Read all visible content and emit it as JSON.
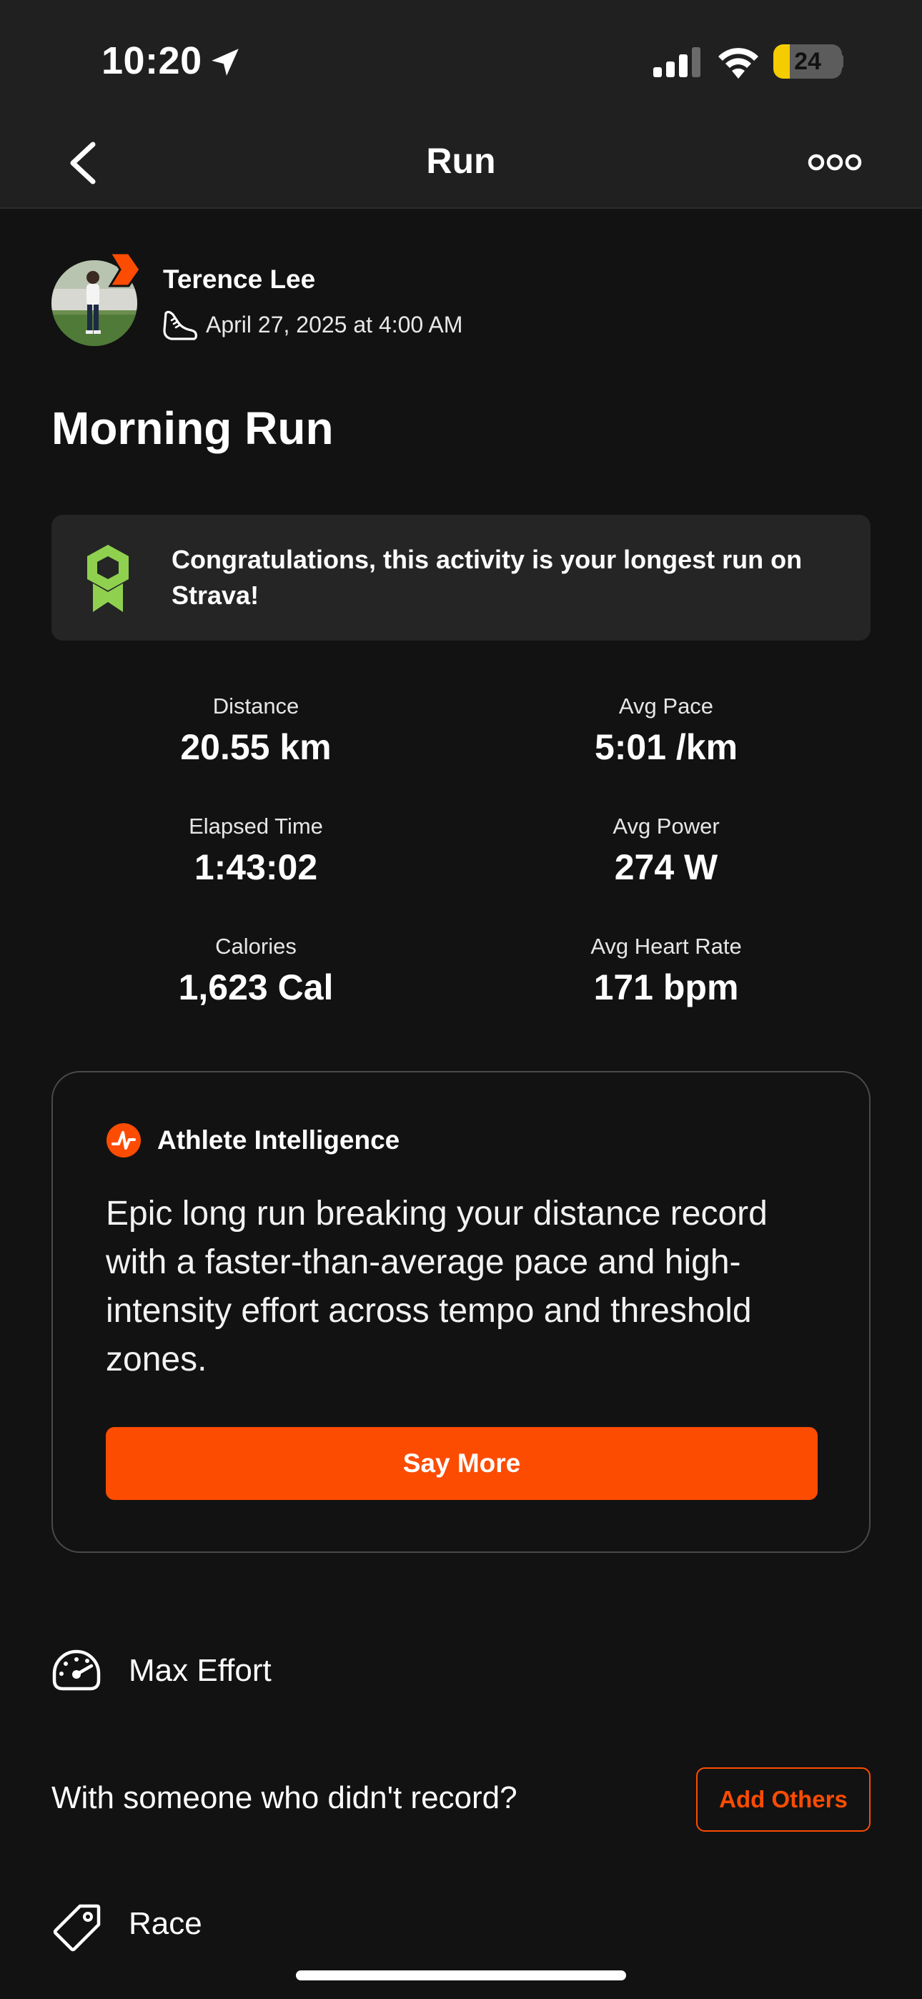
{
  "status_bar": {
    "time": "10:20",
    "battery_level": "24",
    "battery_fraction": 0.24
  },
  "nav": {
    "title": "Run",
    "back_icon": "chevron-left-icon",
    "more_icon": "more-icon"
  },
  "athlete": {
    "name": "Terence Lee",
    "activity_date": "April 27, 2025 at 4:00 AM",
    "activity_icon": "running-shoe-icon"
  },
  "activity": {
    "title": "Morning Run"
  },
  "achievement": {
    "icon": "medal-icon",
    "text": "Congratulations, this activity is your longest run on Strava!"
  },
  "stats": [
    {
      "label": "Distance",
      "value": "20.55 km"
    },
    {
      "label": "Avg Pace",
      "value": "5:01 /km"
    },
    {
      "label": "Elapsed Time",
      "value": "1:43:02"
    },
    {
      "label": "Avg Power",
      "value": "274 W"
    },
    {
      "label": "Calories",
      "value": "1,623 Cal"
    },
    {
      "label": "Avg Heart Rate",
      "value": "171 bpm"
    }
  ],
  "athlete_intelligence": {
    "title": "Athlete Intelligence",
    "summary": "Epic long run breaking your distance record with a faster-than-average pace and high-intensity effort across tempo and threshold zones.",
    "button_label": "Say More"
  },
  "effort": {
    "icon": "speedometer-icon",
    "label": "Max Effort"
  },
  "others": {
    "prompt": "With someone who didn't record?",
    "button_label": "Add Others"
  },
  "workout_type": {
    "icon": "tag-icon",
    "label": "Race"
  },
  "colors": {
    "background": "#121212",
    "header": "#202020",
    "accent": "#fc4c02",
    "medal": "#8fd14f",
    "battery": "#f5cc00"
  }
}
